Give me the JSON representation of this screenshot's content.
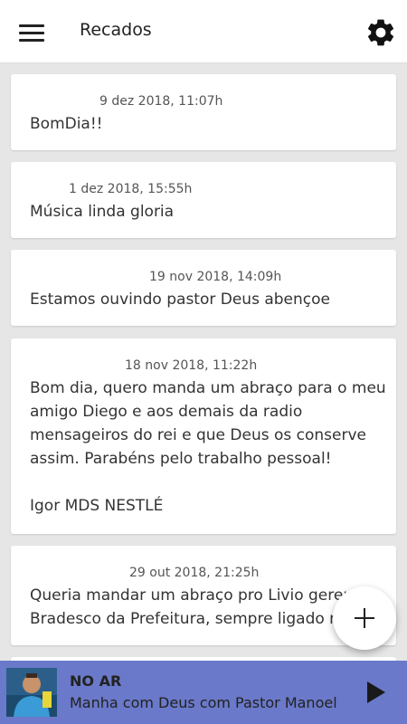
{
  "header": {
    "title": "Recados",
    "menu_icon": "hamburger-menu-icon",
    "settings_icon": "gear-icon"
  },
  "messages": [
    {
      "date": "9 dez 2018, 11:07h",
      "text": "BomDia!!"
    },
    {
      "date": "1 dez 2018, 15:55h",
      "text": "Música linda gloria"
    },
    {
      "date": "19 nov 2018, 14:09h",
      "text": "Estamos ouvindo pastor Deus abençoe"
    },
    {
      "date": "18 nov 2018, 11:22h",
      "text": "Bom dia, quero manda um abraço para o meu\namigo Diego e aos demais da radio\nmensageiros do rei e que Deus os conserve\nassim. Parabéns pelo trabalho pessoal!\n\nIgor MDS NESTLÉ"
    },
    {
      "date": "29 out 2018, 21:25h",
      "text": "Queria mandar um abraço pro Livio gerente\nBradesco da Prefeitura, sempre ligado na"
    }
  ],
  "fab": {
    "icon": "plus-icon"
  },
  "player": {
    "status": "NO AR",
    "show": "Manha com Deus com Pastor Manoel",
    "play_icon": "play-icon",
    "accent": "#6a79c9"
  }
}
